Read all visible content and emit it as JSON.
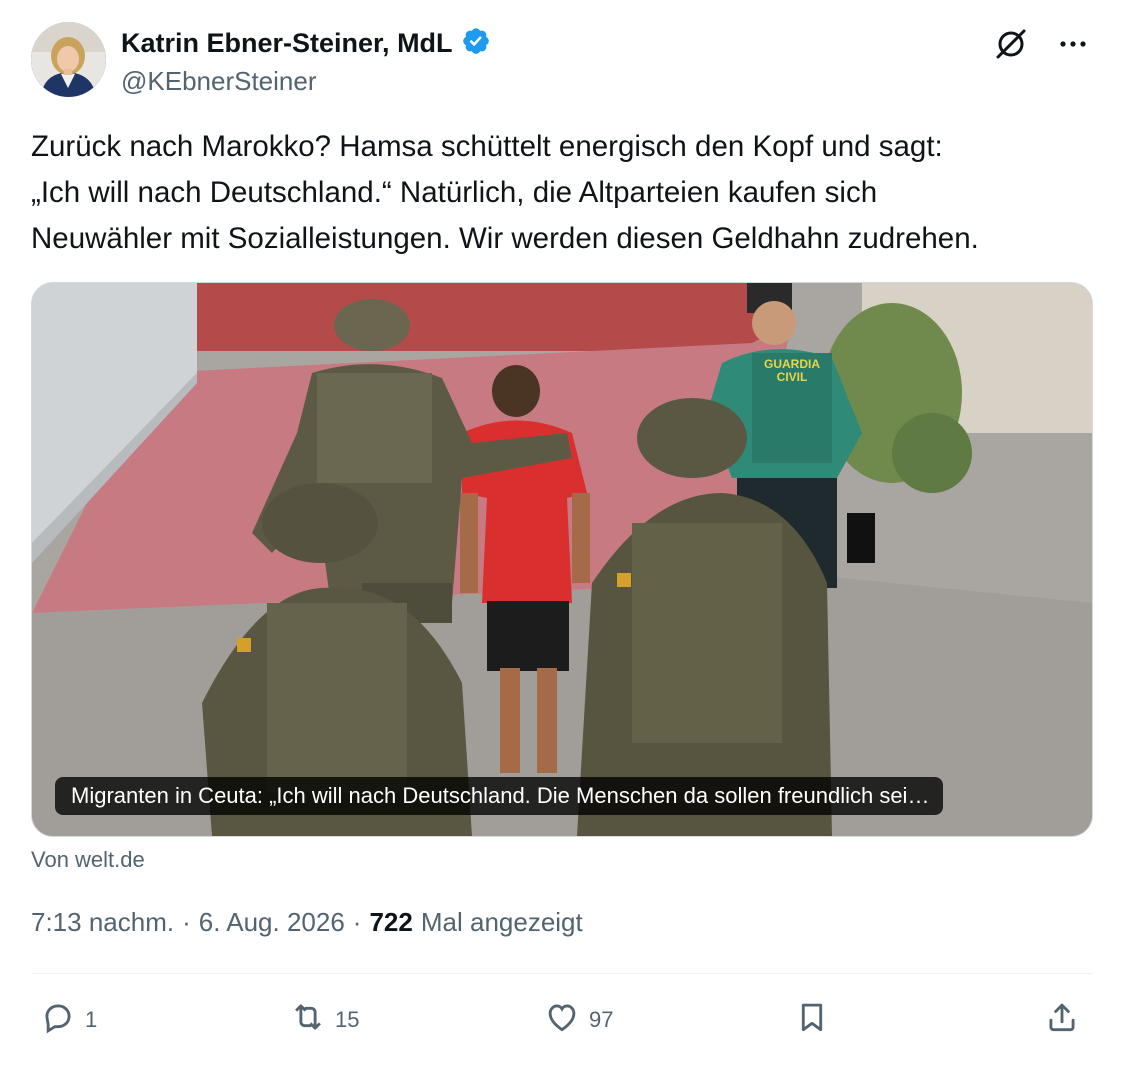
{
  "author": {
    "name": "Katrin Ebner-Steiner, MdL",
    "handle": "@KEbnerSteiner",
    "verified": true,
    "verified_color": "#1d9bf0"
  },
  "tweet": {
    "lines": [
      "Zurück nach Marokko? Hamsa schüttelt energisch den Kopf und sagt:",
      "„Ich will nach Deutschland.“ Natürlich, die Altparteien kaufen sich",
      "Neuwähler mit Sozialleistungen. Wir werden diesen Geldhahn zudrehen."
    ]
  },
  "card": {
    "caption": "Migranten in Ceuta: „Ich will nach Deutschland. Die Menschen da sollen freundlich sei…",
    "source": "Von welt.de",
    "vest_text_1": "GUARDIA",
    "vest_text_2": "CIVIL"
  },
  "meta": {
    "time": "7:13 nachm.",
    "sep1": "·",
    "date": "6. Aug. 2026",
    "sep2": "·",
    "views_count": "722",
    "views_label": "Mal angezeigt"
  },
  "actions": {
    "replies": "1",
    "reposts": "15",
    "likes": "97"
  },
  "icons": {
    "header": [
      "grok-icon",
      "more-icon"
    ],
    "actions": [
      "reply-icon",
      "repost-icon",
      "like-icon",
      "bookmark-icon",
      "share-icon"
    ]
  },
  "colors": {
    "text": "#0f1419",
    "secondary": "#536471",
    "accent": "#1d9bf0"
  }
}
